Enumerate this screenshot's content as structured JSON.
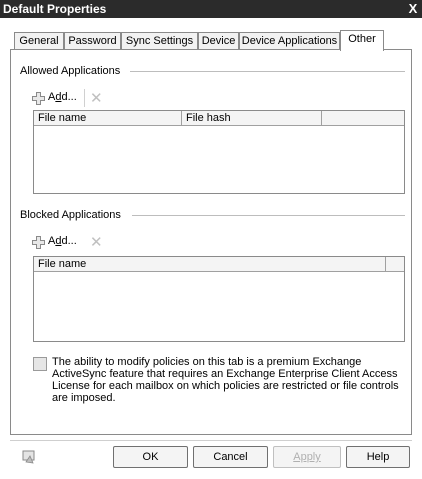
{
  "window": {
    "title": "Default Properties",
    "close_glyph": "X"
  },
  "tabs": [
    {
      "label": "General",
      "active": false
    },
    {
      "label": "Password",
      "active": false
    },
    {
      "label": "Sync Settings",
      "active": false
    },
    {
      "label": "Device",
      "active": false
    },
    {
      "label": "Device Applications",
      "active": false
    },
    {
      "label": "Other",
      "active": true
    }
  ],
  "allowed": {
    "header": "Allowed Applications",
    "add_prefix": "A",
    "add_mnemonic": "d",
    "add_suffix": "d...",
    "delete_glyph": "✕",
    "columns": [
      "File name",
      "File hash"
    ]
  },
  "blocked": {
    "header": "Blocked Applications",
    "add_prefix": "A",
    "add_mnemonic": "d",
    "add_suffix": "d...",
    "delete_glyph": "✕",
    "columns": [
      "File name"
    ]
  },
  "info": {
    "icon": "info-icon",
    "text": "The ability to modify policies on this tab is a premium Exchange ActiveSync feature that requires an Exchange Enterprise Client Access License for each mailbox on which policies are restricted or file controls are imposed."
  },
  "buttons": {
    "ok": "OK",
    "cancel": "Cancel",
    "apply": "Apply",
    "help": "Help"
  },
  "footer_icon": "help-context-icon"
}
